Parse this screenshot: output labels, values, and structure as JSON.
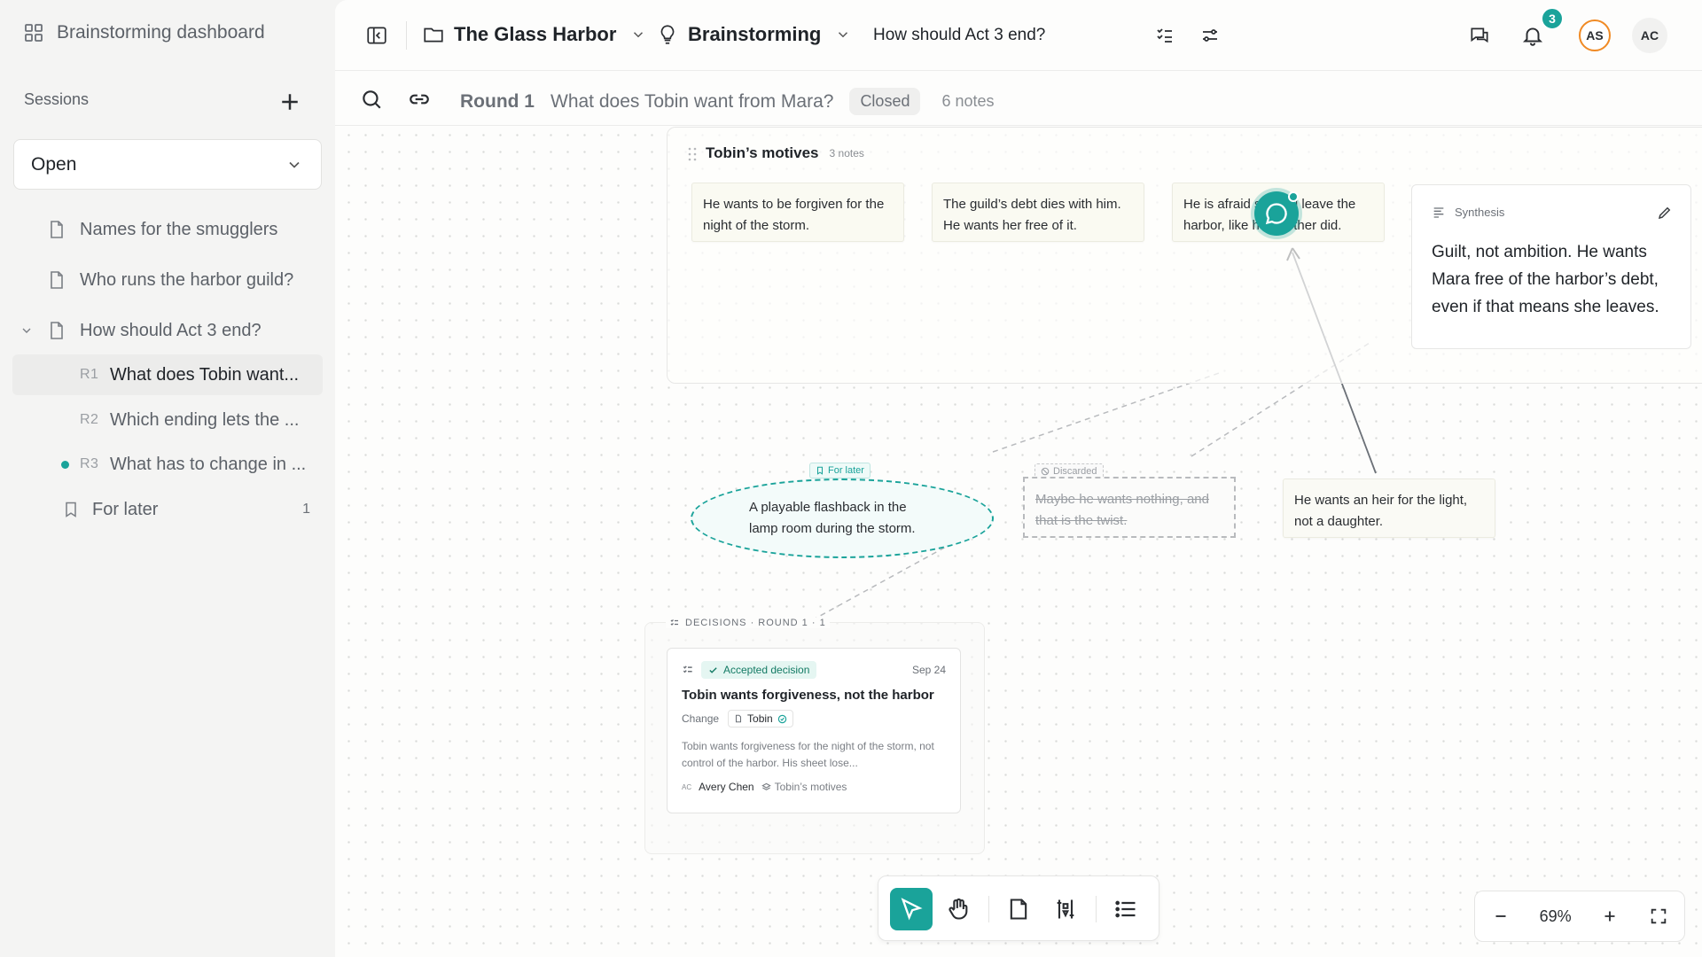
{
  "sidebar": {
    "title": "Brainstorming dashboard",
    "sessions_label": "Sessions",
    "filter_value": "Open",
    "items": [
      {
        "label": "Names for the smugglers"
      },
      {
        "label": "Who runs the harbor guild?"
      },
      {
        "label": "How should Act 3 end?"
      }
    ],
    "rounds": [
      {
        "num": "R1",
        "label": "What does Tobin want..."
      },
      {
        "num": "R2",
        "label": "Which ending lets the ..."
      },
      {
        "num": "R3",
        "label": "What has to change in ..."
      }
    ],
    "for_later": {
      "label": "For later",
      "count": "1"
    }
  },
  "topbar": {
    "project": "The Glass Harbor",
    "mode": "Brainstorming",
    "question": "How should Act 3 end?",
    "notifications": "3",
    "avatars": [
      "AS",
      "AC"
    ]
  },
  "subbar": {
    "round": "Round 1",
    "question": "What does Tobin want from Mara?",
    "status": "Closed",
    "notes": "6 notes"
  },
  "canvas": {
    "group": {
      "title": "Tobin’s motives",
      "count": "3 notes"
    },
    "notes": [
      "He wants to be forgiven for the night of the storm.",
      "The guild’s debt dies with him. He wants her free of it.",
      "He is afraid she will leave the harbor, like her mother did."
    ],
    "synthesis": {
      "label": "Synthesis",
      "text": "Guilt, not ambition. He wants Mara free of the harbor’s debt, even if that means she leaves."
    },
    "for_later_tag": "For later",
    "flashback": "A playable flashback in the lamp room during the storm.",
    "discarded_tag": "Discarded",
    "discarded_note": "Maybe he wants nothing, and that is the twist.",
    "heir_note": "He wants an heir for the light, not a daughter.",
    "decisions": {
      "label": "DECISIONS · ROUND 1 · 1",
      "status": "Accepted decision",
      "date": "Sep 24",
      "title": "Tobin wants forgiveness, not the harbor",
      "change_label": "Change",
      "change_chip": "Tobin",
      "description": "Tobin wants forgiveness for the night of the storm, not control of the harbor. His sheet lose...",
      "author_initials": "AC",
      "author": "Avery Chen",
      "group": "Tobin’s motives"
    }
  },
  "zoom": {
    "value": "69%"
  },
  "colors": {
    "accent": "#1aa39a",
    "sidebar_bg": "#f4f4f3",
    "note_bg": "#fafaf2"
  }
}
